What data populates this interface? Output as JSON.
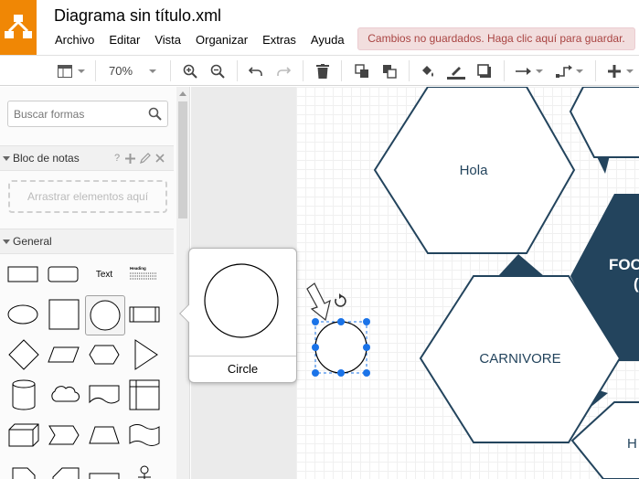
{
  "app": {
    "title": "Diagrama sin título.xml",
    "save_notice": "Cambios no guardados. Haga clic aquí para guardar."
  },
  "menu": [
    "Archivo",
    "Editar",
    "Vista",
    "Organizar",
    "Extras",
    "Ayuda"
  ],
  "toolbar": {
    "zoom": "70%",
    "icons": [
      "format-panel-icon",
      "zoom-in-icon",
      "zoom-out-icon",
      "undo-icon",
      "redo-icon",
      "delete-icon",
      "to-front-icon",
      "to-back-icon",
      "fill-color-icon",
      "line-color-icon",
      "shadow-icon",
      "connection-icon",
      "waypoints-icon",
      "insert-icon"
    ]
  },
  "sidebar": {
    "search_placeholder": "Buscar formas",
    "scratchpad": {
      "title": "Bloc de notas",
      "help": "?",
      "drop_hint": "Arrastrar elementos aquí"
    },
    "general": {
      "title": "General",
      "text_shape_label": "Text",
      "heading_shape_label": "Heading"
    }
  },
  "tooltip": {
    "shape_name": "Circle"
  },
  "diagram": {
    "labels": {
      "hola": "Hola",
      "carnivore": "CARNIVORE",
      "food_partial": "FOO",
      "bottom_partial": "H"
    },
    "colors": {
      "hex_stroke": "#23445d",
      "hex_fill_dark": "#23445d",
      "selection": "#1a73e8"
    }
  },
  "colors": {
    "brand": "#f08705",
    "banner_bg": "#f2dede",
    "banner_text": "#a94442"
  }
}
